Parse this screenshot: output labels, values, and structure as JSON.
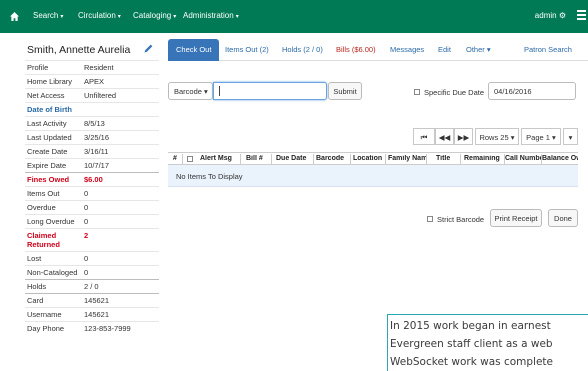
{
  "navbar": {
    "home_icon": "home-icon",
    "items": [
      {
        "label": "Search"
      },
      {
        "label": "Circulation"
      },
      {
        "label": "Cataloging"
      },
      {
        "label": "Administration"
      }
    ],
    "user": "admin",
    "menu_icon": "hamburger-icon",
    "color": "#007a54"
  },
  "patron": {
    "name": "Smith, Annette Aurelia",
    "edit_icon": "pencil-icon",
    "summary": [
      {
        "key": "Profile",
        "value": "Resident"
      },
      {
        "key": "Home Library",
        "value": "APEX"
      },
      {
        "key": "Net Access",
        "value": "Unfiltered"
      },
      {
        "key": "Date of Birth",
        "value": ""
      },
      {
        "key": "Last Activity",
        "value": "8/5/13"
      },
      {
        "key": "Last Updated",
        "value": "3/25/16"
      },
      {
        "key": "Create Date",
        "value": "3/16/11"
      },
      {
        "key": "Expire Date",
        "value": "10/7/17"
      },
      {
        "key": "Fines Owed",
        "value": "$6.00"
      },
      {
        "key": "Items Out",
        "value": "0"
      },
      {
        "key": "Overdue",
        "value": "0"
      },
      {
        "key": "Long Overdue",
        "value": "0"
      },
      {
        "key": "Claimed Returned",
        "value": "2"
      },
      {
        "key": "Lost",
        "value": "0"
      },
      {
        "key": "Non-Cataloged",
        "value": "0"
      },
      {
        "key": "Holds",
        "value": "2 / 0"
      },
      {
        "key": "Card",
        "value": "145621"
      },
      {
        "key": "Username",
        "value": "145621"
      },
      {
        "key": "Day Phone",
        "value": "123-853-7999"
      }
    ],
    "alert_color": "#d0021b"
  },
  "tabs": [
    {
      "label": "Check Out",
      "active": true
    },
    {
      "label": "Items Out (2)"
    },
    {
      "label": "Holds (2 / 0)"
    },
    {
      "label": "Bills ($6.00)"
    },
    {
      "label": "Messages"
    },
    {
      "label": "Edit"
    },
    {
      "label": "Other"
    },
    {
      "label": "Patron Search"
    }
  ],
  "checkout_form": {
    "barcode_type": "Barcode",
    "barcode_value": "",
    "submit_label": "Submit",
    "specific_due_label": "Specific Due Date",
    "due_date": "04/16/2016"
  },
  "pager": {
    "first_icon": "first-page-icon",
    "prev_icon": "previous-page-icon",
    "next_icon": "next-page-icon",
    "rows_label": "Rows 25",
    "page_label": "Page 1",
    "options_icon": "chevron-down-icon"
  },
  "grid": {
    "columns": [
      "#",
      "",
      "Alert Msg",
      "Bill #",
      "Due Date",
      "Barcode",
      "Location",
      "Family Name",
      "Title",
      "Remaining",
      "Call Number",
      "Balance Owed"
    ],
    "empty_message": "No Items To Display"
  },
  "actions": {
    "strict_barcode_label": "Strict Barcode",
    "print_receipt_label": "Print Receipt",
    "done_label": "Done"
  },
  "caption": {
    "lines": [
      "In 2015 work began in earnest",
      "Evergreen staff client as a web",
      "WebSocket work was complete"
    ]
  }
}
